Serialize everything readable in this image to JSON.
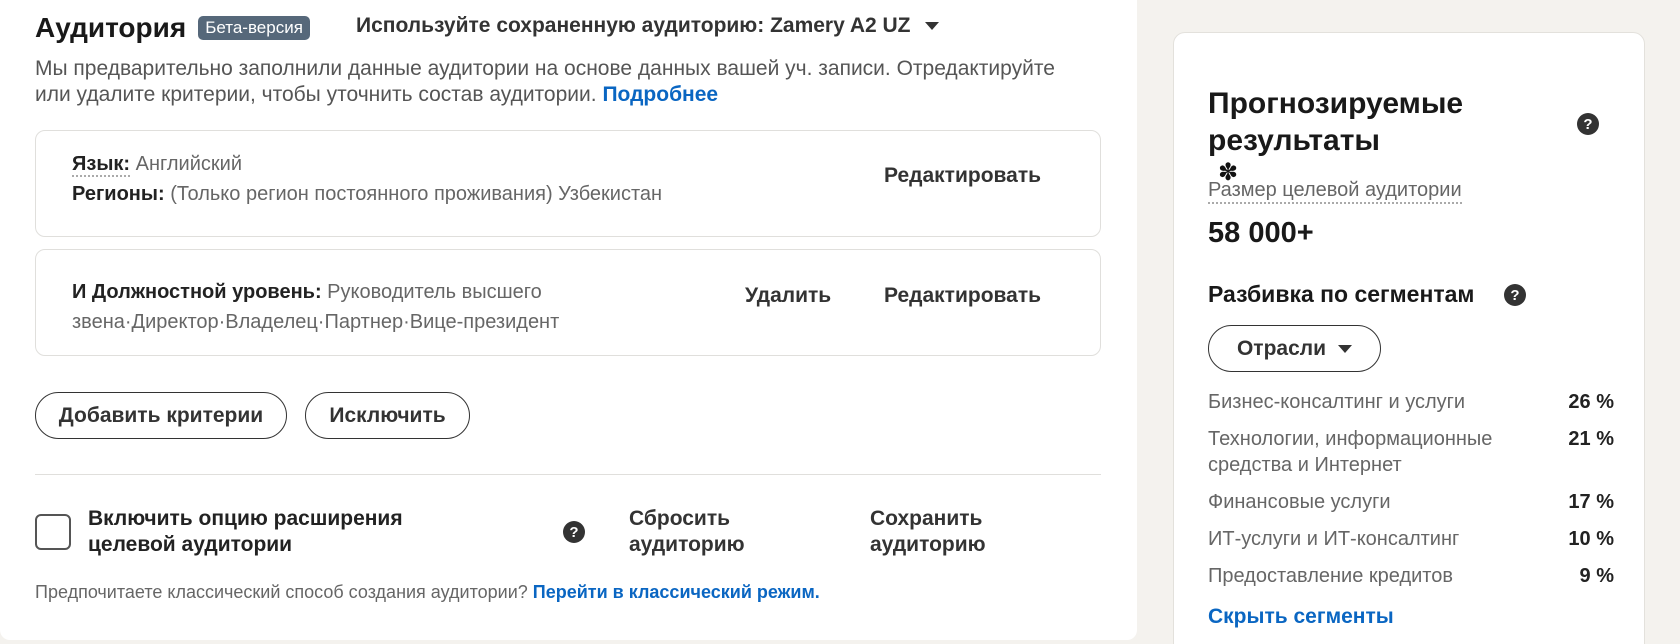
{
  "header": {
    "title": "Аудитория",
    "badge": "Бета-версия",
    "saved_audience": "Используйте сохраненную аудиторию: Zamery A2 UZ"
  },
  "intro": {
    "text": "Мы предварительно заполнили данные аудитории на основе данных вашей уч. записи. Отредактируйте или удалите критерии, чтобы уточнить состав аудитории.",
    "link": "Подробнее"
  },
  "criteria": {
    "card1": {
      "lang_label": "Язык:",
      "lang_value": "Английский",
      "region_label": "Регионы:",
      "region_value": "(Только регион постоянного проживания) Узбекистан",
      "edit": "Редактировать"
    },
    "card2": {
      "label": "И Должностной уровень:",
      "value_line1": "Руководитель высшего",
      "value_line2": "звена·Директор·Владелец·Партнер·Вице-президент",
      "delete": "Удалить",
      "edit": "Редактировать"
    }
  },
  "buttons": {
    "add": "Добавить критерии",
    "exclude": "Исключить",
    "reset": "Сбросить аудиторию",
    "save": "Сохранить аудиторию"
  },
  "expansion": {
    "label": "Включить опцию расширения целевой аудитории",
    "checked": false
  },
  "classic": {
    "text": "Предпочитаете классический способ создания аудитории?",
    "link": "Перейти в классический режим."
  },
  "sidebar": {
    "title": "Прогнозируемые результаты",
    "size_label": "Размер целевой аудитории",
    "size_value": "58 000+",
    "segments_title": "Разбивка по сегментам",
    "dropdown": "Отрасли",
    "segments": [
      {
        "name": "Бизнес-консалтинг и услуги",
        "pct": "26 %"
      },
      {
        "name": "Технологии, информационные средства и Интернет",
        "pct": "21 %"
      },
      {
        "name": "Финансовые услуги",
        "pct": "17 %"
      },
      {
        "name": "ИТ-услуги и ИТ-консалтинг",
        "pct": "10 %"
      },
      {
        "name": "Предоставление кредитов",
        "pct": "9 %"
      }
    ],
    "hide": "Скрыть сегменты"
  },
  "colors": {
    "link": "#0a66c2",
    "badge": "#56687a"
  }
}
